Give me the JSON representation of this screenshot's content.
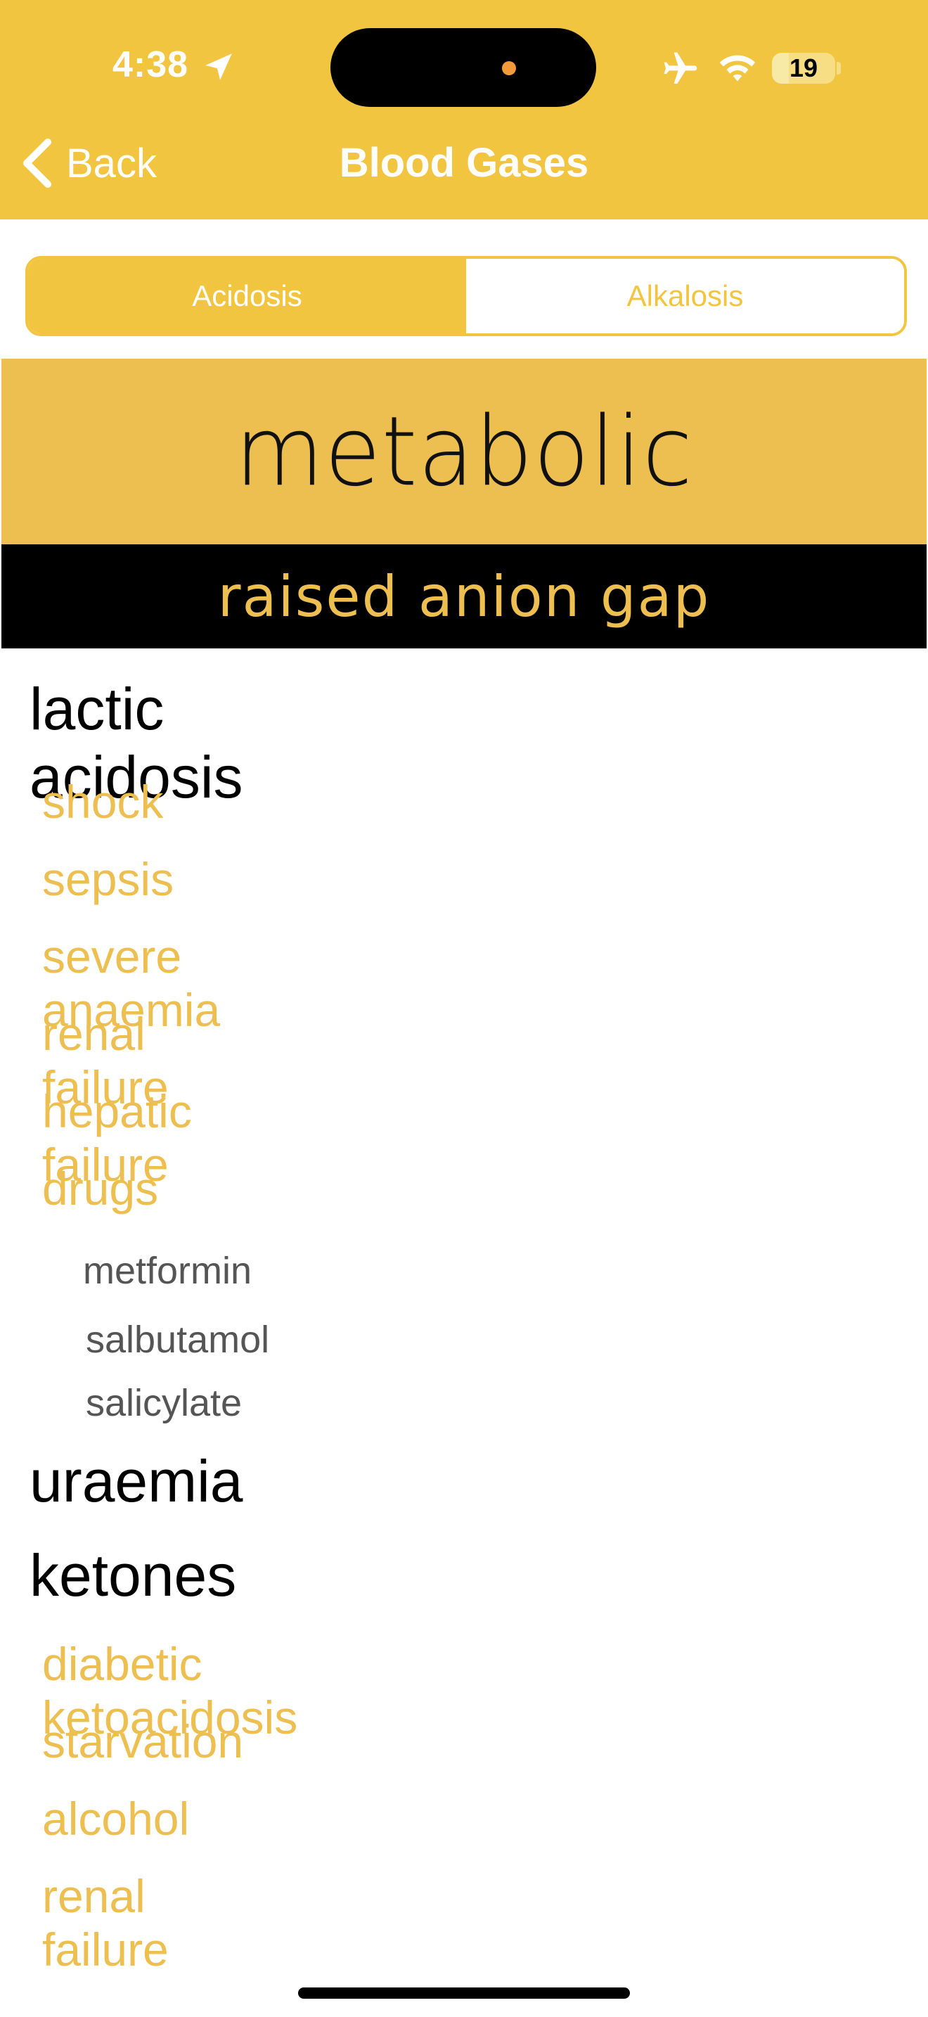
{
  "status_bar": {
    "time": "4:38",
    "battery": "19"
  },
  "nav": {
    "back_label": "Back",
    "title": "Blood Gases"
  },
  "tabs": [
    {
      "label": "Acidosis",
      "selected": true
    },
    {
      "label": "Alkalosis",
      "selected": false
    }
  ],
  "banner": {
    "title": "metabolic",
    "subtitle": "raised anion gap"
  },
  "sections": [
    {
      "heading": "lactic acidosis",
      "items": [
        "shock",
        "sepsis",
        "severe anaemia",
        "renal failure",
        "hepatic failure",
        "drugs"
      ],
      "subitems": [
        "metformin",
        "salbutamol",
        "salicylate"
      ]
    },
    {
      "heading": "uraemia"
    },
    {
      "heading": "ketones",
      "items": [
        "diabetic ketoacidosis",
        "starvation",
        "alcohol",
        "renal failure"
      ]
    }
  ],
  "colors": {
    "accent": "#F2C540",
    "banner": "#EDBE50",
    "black": "#000000"
  },
  "icons": [
    "location-arrow-icon",
    "airplane-icon",
    "wifi-icon",
    "battery-icon",
    "chevron-left-icon"
  ]
}
